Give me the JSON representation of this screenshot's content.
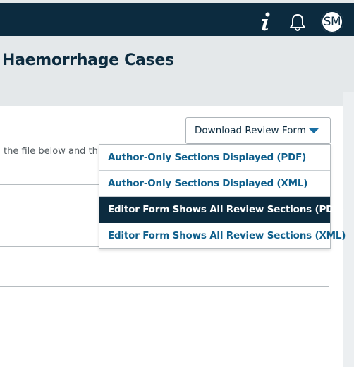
{
  "header": {
    "avatar_initials": "SM",
    "icons": [
      "info-icon",
      "bell-icon"
    ],
    "background_color": "#0c2b3f"
  },
  "page": {
    "title": "Haemorrhage Cases"
  },
  "content": {
    "instruction_text": "the file below and th"
  },
  "download": {
    "button_label": "Download Review Form",
    "caret_icon": "caret-down-icon",
    "menu": [
      {
        "label": "Author-Only Sections Displayed (PDF)",
        "active": false
      },
      {
        "label": "Author-Only Sections Displayed (XML)",
        "active": false
      },
      {
        "label": "Editor Form Shows All Review Sections (PDF)",
        "active": true
      },
      {
        "label": "Editor Form Shows All Review Sections (XML)",
        "active": false
      }
    ]
  },
  "colors": {
    "navy": "#0c2b3f",
    "link_blue": "#0f5f8c",
    "page_background": "#e4e8ea"
  }
}
